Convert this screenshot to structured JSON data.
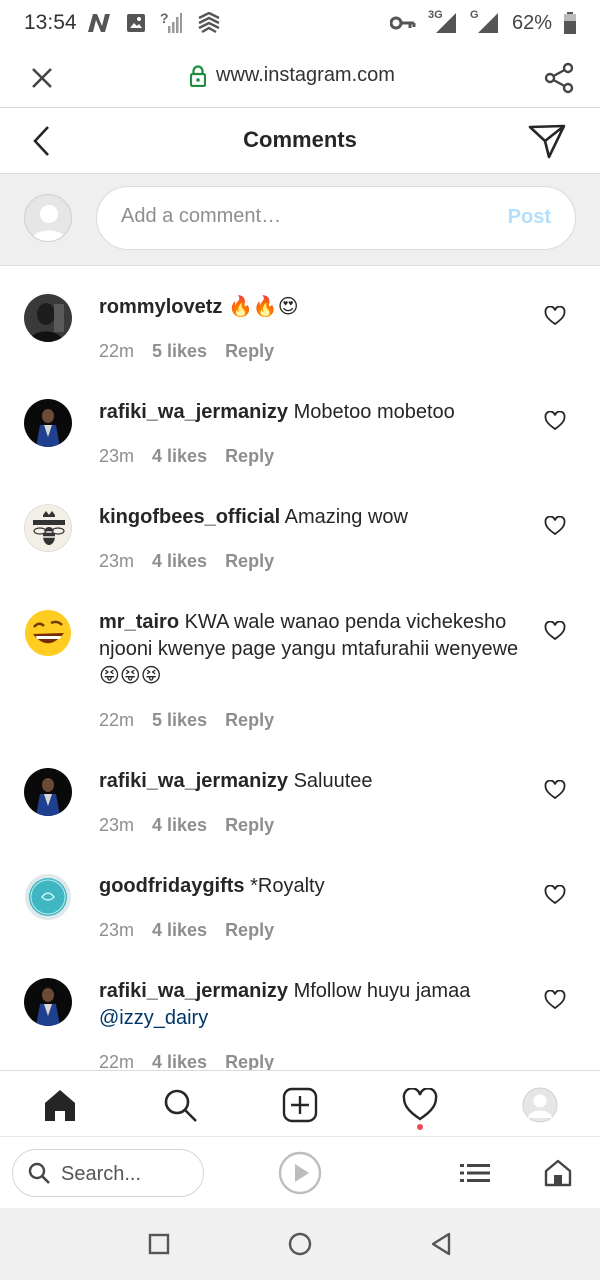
{
  "status_bar": {
    "time": "13:54",
    "network_3g": "3G",
    "network_g": "G",
    "unknown_signal": "?",
    "battery": "62%"
  },
  "browser": {
    "url": "www.instagram.com"
  },
  "header": {
    "title": "Comments"
  },
  "composer": {
    "placeholder": "Add a comment…",
    "post_label": "Post"
  },
  "comments": [
    {
      "username": "rommylovetz",
      "text": "🔥🔥😍",
      "time": "22m",
      "likes": "5 likes",
      "reply": "Reply"
    },
    {
      "username": "rafiki_wa_jermanizy",
      "text": "Mobetoo mobetoo",
      "time": "23m",
      "likes": "4 likes",
      "reply": "Reply"
    },
    {
      "username": "kingofbees_official",
      "text": "Amazing wow",
      "time": "23m",
      "likes": "4 likes",
      "reply": "Reply"
    },
    {
      "username": "mr_tairo",
      "text": "KWA wale wanao penda vichekesho njooni kwenye page yangu mtafurahii wenyewe😝😝😝",
      "time": "22m",
      "likes": "5 likes",
      "reply": "Reply"
    },
    {
      "username": "rafiki_wa_jermanizy",
      "text": "Saluutee",
      "time": "23m",
      "likes": "4 likes",
      "reply": "Reply"
    },
    {
      "username": "goodfridaygifts",
      "text": "*Royalty",
      "time": "23m",
      "likes": "4 likes",
      "reply": "Reply"
    },
    {
      "username": "rafiki_wa_jermanizy",
      "text": "Mfollow huyu jamaa",
      "mention": "@izzy_dairy",
      "time": "22m",
      "likes": "4 likes",
      "reply": "Reply"
    }
  ],
  "bottom_nav": {
    "items": [
      "home-icon",
      "search-icon",
      "new-post-icon",
      "activity-heart-icon",
      "profile-icon"
    ],
    "notification_color": "#ed4956"
  },
  "browser_toolbar": {
    "search_placeholder": "Search..."
  },
  "colors": {
    "post_disabled": "#b2dffc",
    "secure_lock": "#1e8e3e",
    "mention": "#003569"
  }
}
